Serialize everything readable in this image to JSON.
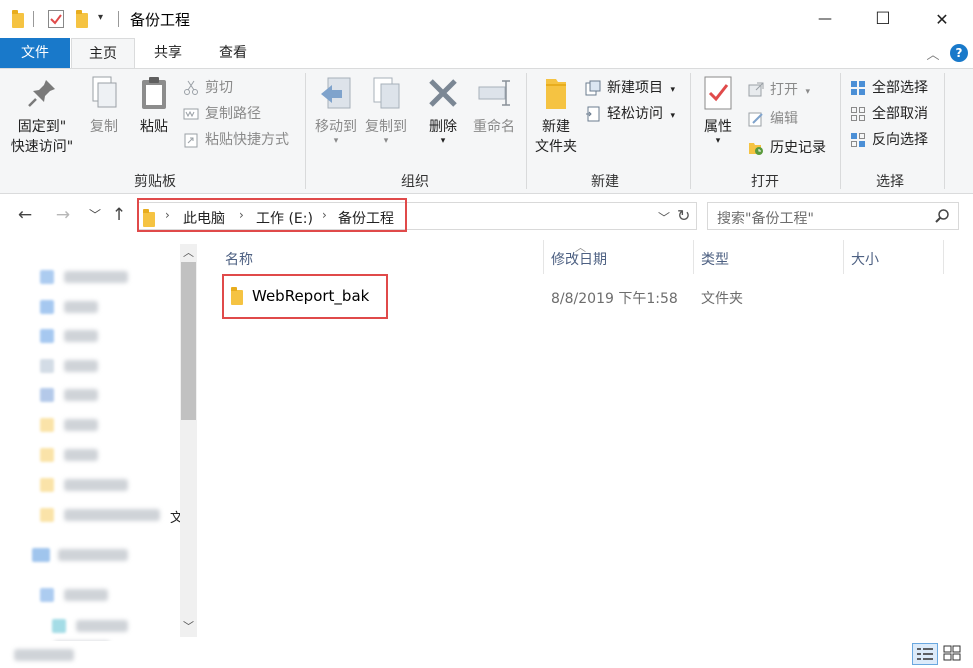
{
  "window": {
    "title": "备份工程",
    "minimize": "—",
    "maximize": "☐",
    "close": "✕"
  },
  "tabs": {
    "file": "文件",
    "home": "主页",
    "share": "共享",
    "view": "查看",
    "help": "?"
  },
  "ribbon": {
    "clipboard": {
      "label": "剪贴板",
      "pin_line1": "固定到\"",
      "pin_line2": "快速访问\"",
      "copy": "复制",
      "paste": "粘贴",
      "cut": "剪切",
      "copy_path": "复制路径",
      "paste_shortcut": "粘贴快捷方式"
    },
    "organize": {
      "label": "组织",
      "move_to": "移动到",
      "copy_to": "复制到",
      "delete": "删除",
      "rename": "重命名"
    },
    "new": {
      "label": "新建",
      "new_folder_line1": "新建",
      "new_folder_line2": "文件夹",
      "new_item": "新建项目",
      "easy_access": "轻松访问"
    },
    "open": {
      "label": "打开",
      "properties": "属性",
      "open": "打开",
      "edit": "编辑",
      "history": "历史记录"
    },
    "select": {
      "label": "选择",
      "select_all": "全部选择",
      "select_none": "全部取消",
      "invert": "反向选择"
    }
  },
  "address": {
    "crumbs": [
      "此电脑",
      "工作 (E:)",
      "备份工程"
    ],
    "search_placeholder": "搜索\"备份工程\""
  },
  "columns": {
    "name": "名称",
    "date": "修改日期",
    "type": "类型",
    "size": "大小"
  },
  "files": [
    {
      "name": "WebReport_bak",
      "date": "8/8/2019 下午1:58",
      "type": "文件夹",
      "size": ""
    }
  ],
  "sidebar": {
    "cut_char": "文"
  },
  "colors": {
    "accent": "#1979ca",
    "highlight_box": "#e04a4a",
    "folder": "#f5c342"
  }
}
